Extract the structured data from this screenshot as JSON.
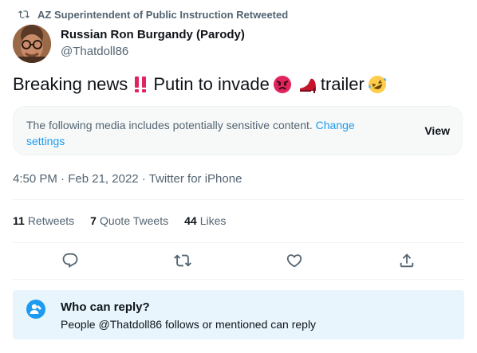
{
  "retweet": {
    "text": "AZ Superintendent of Public Instruction Retweeted",
    "icon": "retweet-icon"
  },
  "author": {
    "name": "Russian Ron Burgandy (Parody)",
    "handle": "@Thatdoll86"
  },
  "tweet": {
    "part1": "Breaking news",
    "part2": "Putin to invade",
    "part3": "trailer",
    "emojis": [
      "double-exclamation-emoji",
      "angry-face-emoji",
      "high-heel-emoji",
      "rolling-laughing-emoji"
    ]
  },
  "sensitive": {
    "text": "The following media includes potentially sensitive content.",
    "link": "Change settings",
    "button": "View"
  },
  "meta": {
    "time": "4:50 PM",
    "date": "Feb 21, 2022",
    "source": "Twitter for iPhone",
    "separator": " · "
  },
  "stats": [
    {
      "count": "11",
      "label": "Retweets"
    },
    {
      "count": "7",
      "label": "Quote Tweets"
    },
    {
      "count": "44",
      "label": "Likes"
    }
  ],
  "actions": [
    "reply-icon",
    "retweet-icon",
    "like-icon",
    "share-icon"
  ],
  "reply_restriction": {
    "title": "Who can reply?",
    "description": "People @Thatdoll86 follows or mentioned can reply"
  },
  "colors": {
    "accent": "#1d9bf0",
    "muted": "#536471",
    "text": "#0f1419",
    "reply_bg": "#e8f5fd"
  }
}
